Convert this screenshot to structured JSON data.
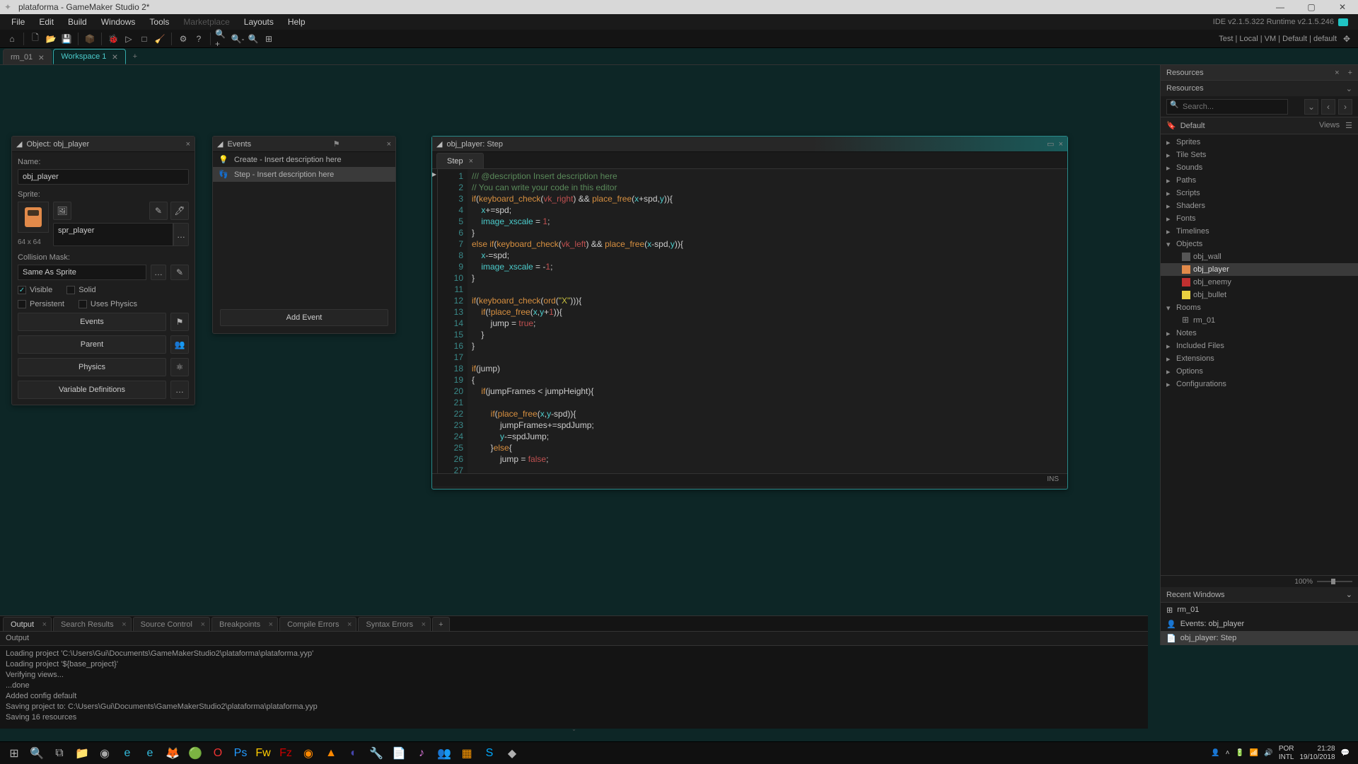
{
  "window": {
    "title": "plataforma - GameMaker Studio 2*",
    "ide_version": "IDE v2.1.5.322 Runtime v2.1.5.246"
  },
  "menu": [
    "File",
    "Edit",
    "Build",
    "Windows",
    "Tools",
    "Marketplace",
    "Layouts",
    "Help"
  ],
  "menu_disabled_index": 5,
  "toolbar_targets": "Test  |  Local  |  VM  |  Default  |  default",
  "top_tabs": {
    "inactive": "rm_01",
    "active": "Workspace 1"
  },
  "object_panel": {
    "title": "Object: obj_player",
    "name_label": "Name:",
    "name_value": "obj_player",
    "sprite_label": "Sprite:",
    "sprite_name": "spr_player",
    "sprite_size": "64 x 64",
    "mask_label": "Collision Mask:",
    "mask_value": "Same As Sprite",
    "chk_visible": "Visible",
    "chk_solid": "Solid",
    "chk_persistent": "Persistent",
    "chk_uses_physics": "Uses Physics",
    "btn_events": "Events",
    "btn_parent": "Parent",
    "btn_physics": "Physics",
    "btn_vardef": "Variable Definitions"
  },
  "events_panel": {
    "title": "Events",
    "items": [
      {
        "icon": "💡",
        "label": "Create - Insert description here",
        "selected": false
      },
      {
        "icon": "👣",
        "label": "Step - Insert description here",
        "selected": true
      }
    ],
    "add_event": "Add Event"
  },
  "code_panel": {
    "title": "obj_player: Step",
    "tab": "Step",
    "status_mode": "INS",
    "lines_count": 27
  },
  "output": {
    "tabs": [
      "Output",
      "Search Results",
      "Source Control",
      "Breakpoints",
      "Compile Errors",
      "Syntax Errors"
    ],
    "active_tab_index": 0,
    "header": "Output",
    "content": [
      "Loading project 'C:\\Users\\Gui\\Documents\\GameMakerStudio2\\plataforma\\plataforma.yyp'",
      "Loading project '${base_project}'",
      "Verifying views...",
      "...done",
      "Added config default",
      "Saving project to: C:\\Users\\Gui\\Documents\\GameMakerStudio2\\plataforma\\plataforma.yyp",
      "Saving 16 resources"
    ]
  },
  "resources": {
    "tab_label": "Resources",
    "header": "Resources",
    "search_placeholder": "Search...",
    "default_label": "Default",
    "views_label": "Views",
    "tree": [
      {
        "label": "Sprites",
        "expanded": false
      },
      {
        "label": "Tile Sets",
        "expanded": false
      },
      {
        "label": "Sounds",
        "expanded": false
      },
      {
        "label": "Paths",
        "expanded": false
      },
      {
        "label": "Scripts",
        "expanded": false
      },
      {
        "label": "Shaders",
        "expanded": false
      },
      {
        "label": "Fonts",
        "expanded": false
      },
      {
        "label": "Timelines",
        "expanded": false
      },
      {
        "label": "Objects",
        "expanded": true,
        "children": [
          {
            "label": "obj_wall",
            "ico": "obj-wall"
          },
          {
            "label": "obj_player",
            "ico": "obj-player",
            "selected": true
          },
          {
            "label": "obj_enemy",
            "ico": "obj-enemy"
          },
          {
            "label": "obj_bullet",
            "ico": "obj-bullet"
          }
        ]
      },
      {
        "label": "Rooms",
        "expanded": true,
        "children": [
          {
            "label": "rm_01",
            "ico": "room"
          }
        ]
      },
      {
        "label": "Notes",
        "expanded": false
      },
      {
        "label": "Included Files",
        "expanded": false
      },
      {
        "label": "Extensions",
        "expanded": false
      },
      {
        "label": "Options",
        "expanded": false
      },
      {
        "label": "Configurations",
        "expanded": false
      }
    ],
    "zoom": "100%",
    "recent_header": "Recent Windows",
    "recent": [
      {
        "icon": "⊞",
        "label": "rm_01"
      },
      {
        "icon": "👤",
        "label": "Events: obj_player"
      },
      {
        "icon": "📄",
        "label": "obj_player: Step",
        "selected": true
      }
    ]
  },
  "taskbar": {
    "lang1": "POR",
    "lang2": "INTL",
    "time": "21:28",
    "date": "19/10/2018"
  }
}
